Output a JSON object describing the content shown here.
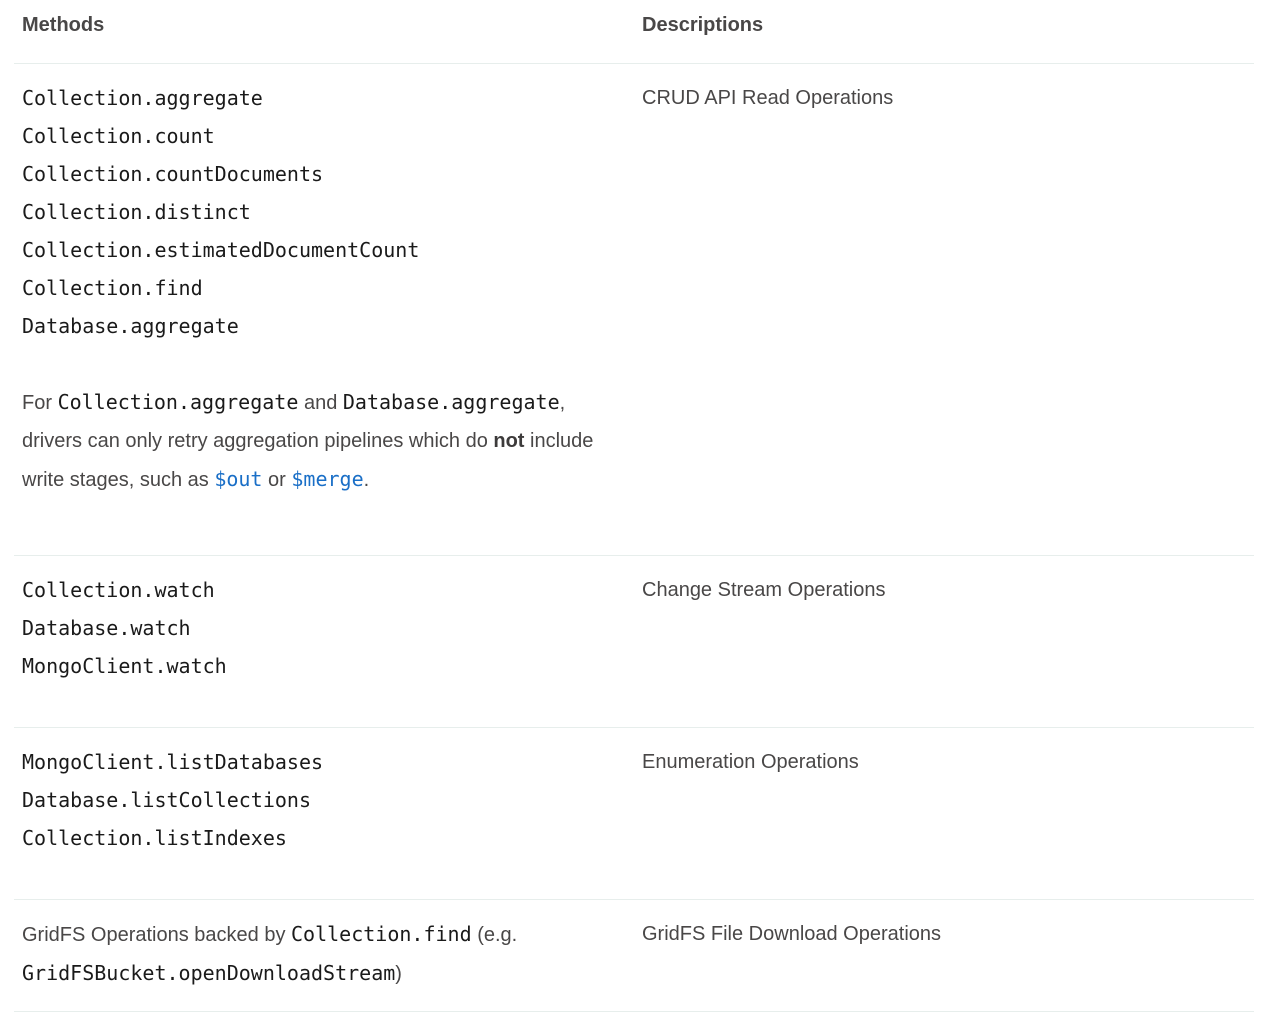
{
  "header": {
    "methods": "Methods",
    "descriptions": "Descriptions"
  },
  "rows": [
    {
      "methods": [
        "Collection.aggregate",
        "Collection.count",
        "Collection.countDocuments",
        "Collection.distinct",
        "Collection.estimatedDocumentCount",
        "Collection.find",
        "Database.aggregate"
      ],
      "note": {
        "t1": "For ",
        "c1": "Collection.aggregate",
        "t2": " and ",
        "c2": "Database.aggregate",
        "t3": ", drivers can only retry aggregation pipelines which do ",
        "bold": "not",
        "t4": " include write stages, such as ",
        "link1": "$out",
        "t5": " or ",
        "link2": "$merge",
        "t6": "."
      },
      "description": "CRUD API Read Operations"
    },
    {
      "methods": [
        "Collection.watch",
        "Database.watch",
        "MongoClient.watch"
      ],
      "description": "Change Stream Operations"
    },
    {
      "methods": [
        "MongoClient.listDatabases",
        "Database.listCollections",
        "Collection.listIndexes"
      ],
      "description": "Enumeration Operations"
    },
    {
      "gridfs": {
        "t1": "GridFS Operations backed by ",
        "c1": "Collection.find",
        "t2": " (e.g. ",
        "c2": "GridFSBucket.openDownloadStream",
        "t3": ")"
      },
      "description": "GridFS File Download Operations"
    }
  ]
}
